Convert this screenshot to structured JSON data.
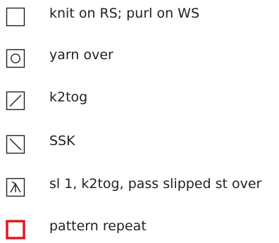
{
  "legend": {
    "items": [
      {
        "symbol": "empty-square-icon",
        "label": "knit on RS; purl on WS"
      },
      {
        "symbol": "circle-in-square-icon",
        "label": "yarn over"
      },
      {
        "symbol": "forward-slash-square-icon",
        "label": "k2tog"
      },
      {
        "symbol": "back-slash-square-icon",
        "label": "SSK"
      },
      {
        "symbol": "inverted-v-square-icon",
        "label": "sl 1, k2tog, pass slipped st over"
      },
      {
        "symbol": "red-square-outline-icon",
        "label": "pattern repeat"
      }
    ],
    "colors": {
      "text": "#231f20",
      "symbol_stroke": "#231f20",
      "repeat_outline": "#e3141b"
    }
  }
}
